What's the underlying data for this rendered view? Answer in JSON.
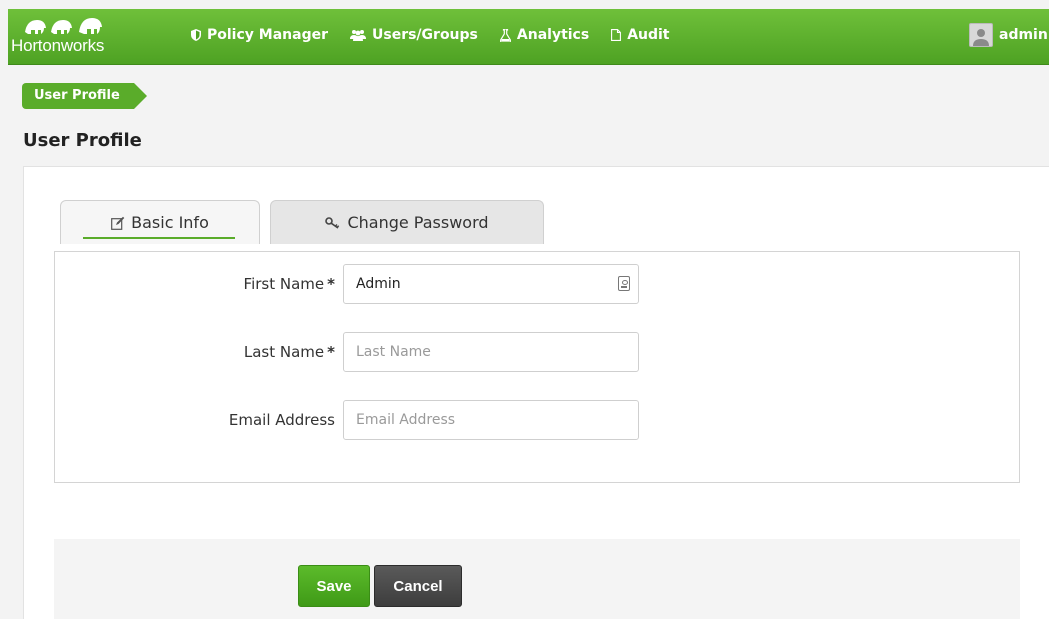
{
  "brand": {
    "name": "Hortonworks"
  },
  "nav": {
    "items": [
      {
        "label": "Policy Manager",
        "icon": "shield-icon"
      },
      {
        "label": "Users/Groups",
        "icon": "users-icon"
      },
      {
        "label": "Analytics",
        "icon": "flask-icon"
      },
      {
        "label": "Audit",
        "icon": "file-icon"
      }
    ],
    "user": {
      "name": "admin",
      "icon": "avatar-icon"
    }
  },
  "breadcrumb": {
    "items": [
      "User Profile"
    ]
  },
  "page": {
    "title": "User Profile"
  },
  "tabs": [
    {
      "label": "Basic Info",
      "icon": "edit-icon",
      "active": true
    },
    {
      "label": "Change Password",
      "icon": "key-icon",
      "active": false
    }
  ],
  "form": {
    "first_name": {
      "label": "First Name",
      "required": "*",
      "value": "Admin",
      "placeholder": ""
    },
    "last_name": {
      "label": "Last Name",
      "required": "*",
      "value": "",
      "placeholder": "Last Name"
    },
    "email": {
      "label": "Email Address",
      "value": "",
      "placeholder": "Email Address"
    }
  },
  "actions": {
    "save": "Save",
    "cancel": "Cancel"
  },
  "colors": {
    "accent": "#5aac2a",
    "nav_bg": "#5aac2a",
    "cancel_bg": "#444444"
  }
}
